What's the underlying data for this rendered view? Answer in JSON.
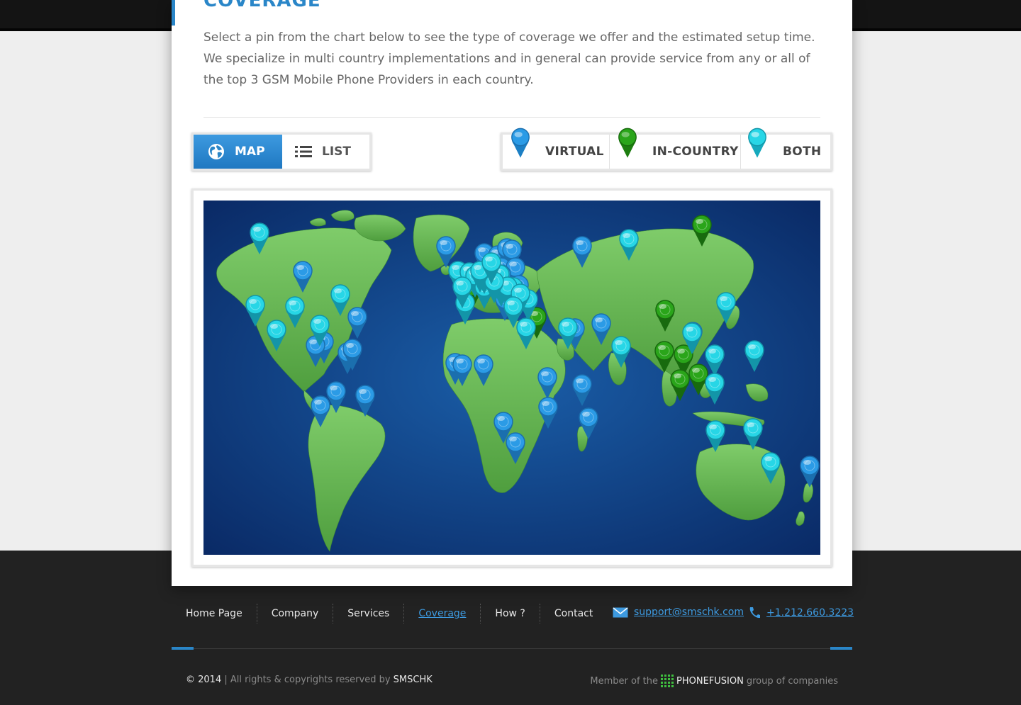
{
  "page": {
    "title": "COVERAGE",
    "intro": "Select a pin from the chart below to see the type of coverage we offer and the estimated setup time. We specialize in multi country implementations and in general can provide service from any or all of the top 3 GSM Mobile Phone Providers in each country."
  },
  "view_toggle": {
    "map_label": "MAP",
    "list_label": "LIST",
    "active": "map"
  },
  "legend": {
    "virtual_label": "VIRTUAL",
    "incountry_label": "IN-COUNTRY",
    "both_label": "BOTH",
    "colors": {
      "virtual": "#2b9be6",
      "incountry": "#2aa51a",
      "both": "#27d6e6"
    }
  },
  "map": {
    "pin_counts": {
      "virtual": 34,
      "incountry": 9,
      "both": 37
    }
  },
  "footer": {
    "nav": [
      "Home Page",
      "Company",
      "Services",
      "Coverage",
      "How ?",
      "Contact"
    ],
    "active_nav": "Coverage",
    "email": "support@smschk.com",
    "phone": "+1.212.660.3223",
    "copyright_prefix": "© 2014",
    "copyright_text": "| All rights & copyrights reserved by",
    "company": "SMSCHK",
    "member_prefix": "Member of the",
    "member_brand": "PHONEFUSION",
    "member_suffix": "group of companies"
  }
}
